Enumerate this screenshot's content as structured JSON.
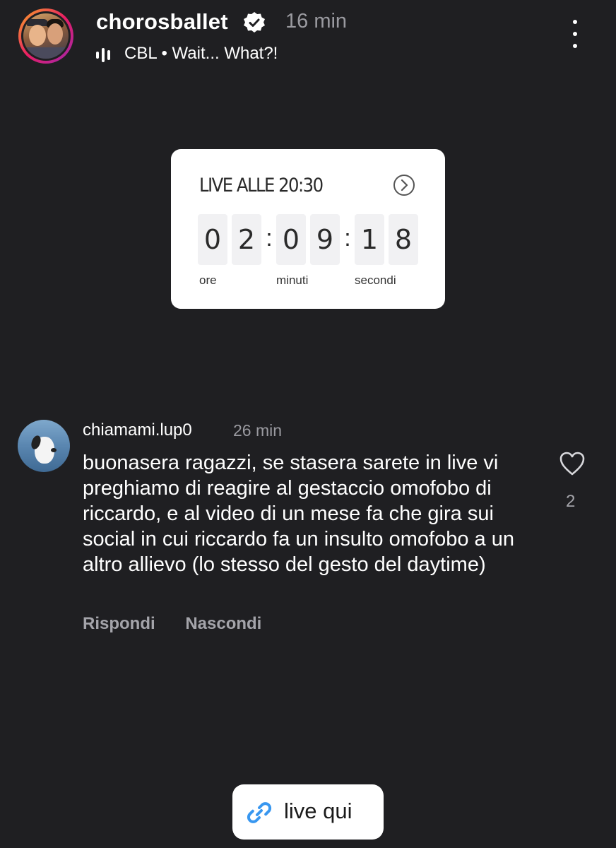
{
  "header": {
    "username": "chorosballet",
    "time": "16 min",
    "audio_label": "CBL • Wait... What?!"
  },
  "countdown": {
    "title": "LIVE ALLE 20:30",
    "digits": [
      "0",
      "2",
      "0",
      "9",
      "1",
      "8"
    ],
    "labels": {
      "hours": "ore",
      "minutes": "minuti",
      "seconds": "secondi"
    }
  },
  "comment": {
    "username": "chiamami.lup0",
    "time": "26 min",
    "text": "buonasera ragazzi, se stasera sarete in live vi preghiamo di reagire al gestaccio omofobo di riccardo, e al video di un mese fa che gira sui social in cui riccardo fa un insulto omofobo a un altro allievo (lo stesso del gesto del daytime)",
    "like_count": "2",
    "reply_label": "Rispondi",
    "hide_label": "Nascondi"
  },
  "link_sticker": {
    "label": "live qui",
    "accent_color": "#3897f0"
  }
}
